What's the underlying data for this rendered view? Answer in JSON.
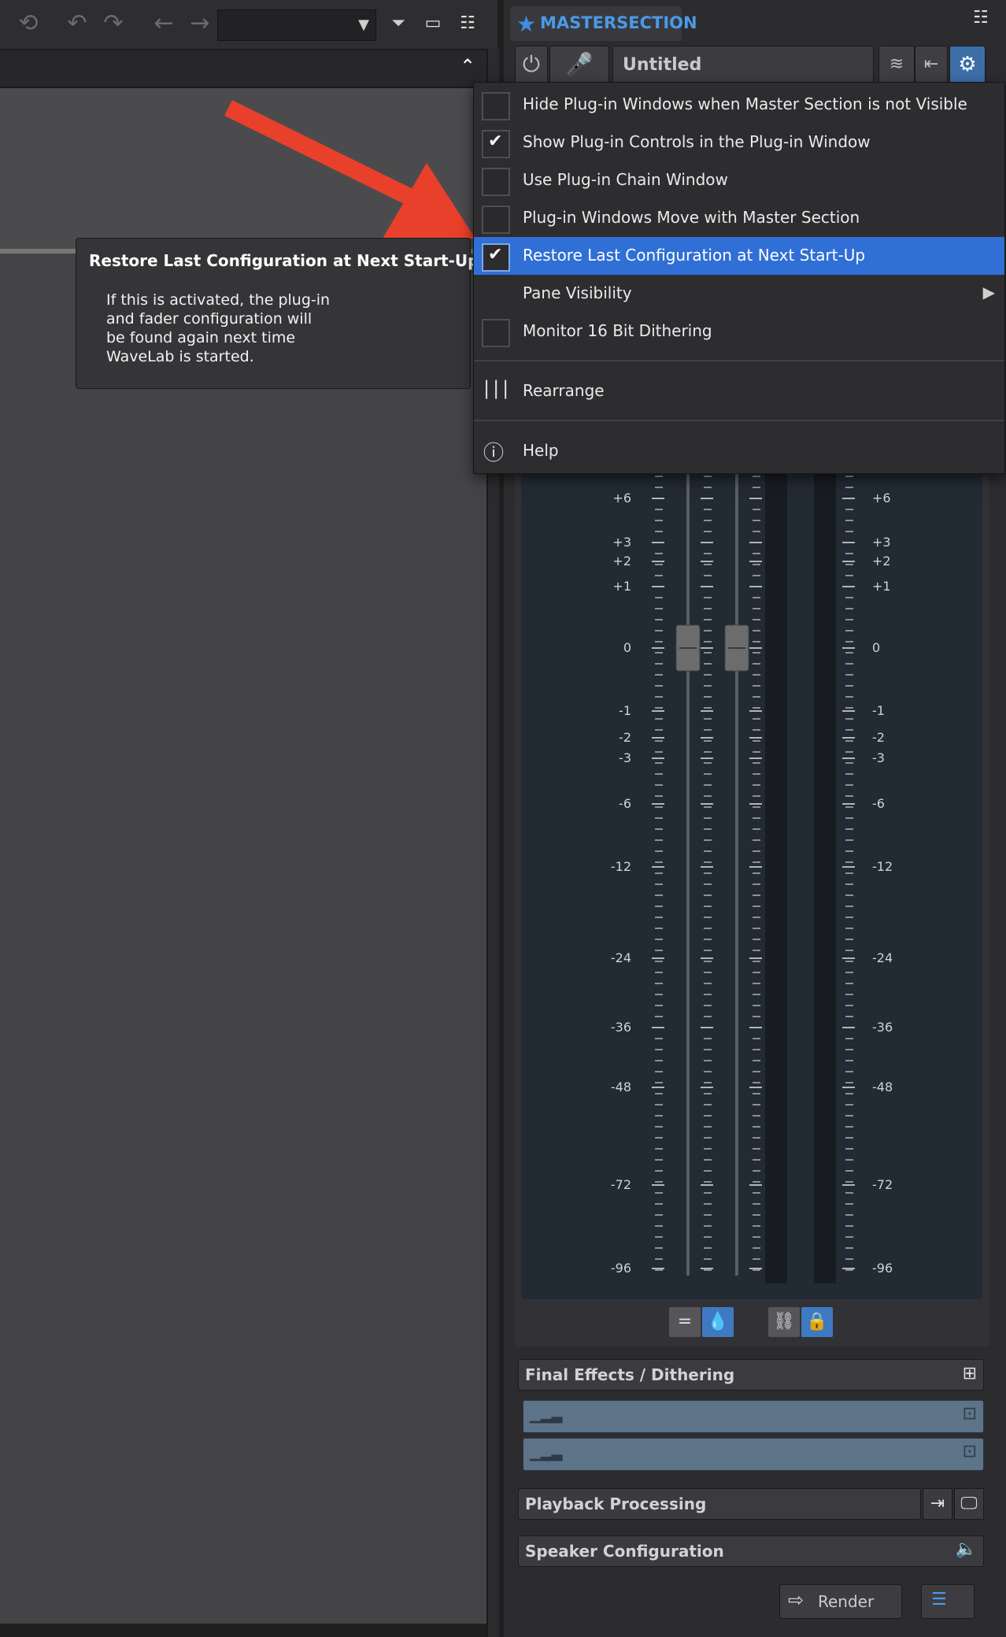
{
  "left_toolbar": {
    "icons": [
      "refresh-icon",
      "undo-icon",
      "redo-icon",
      "arrow-left-icon",
      "arrow-right-icon",
      "collapse-icon",
      "window-icon",
      "layout-icon"
    ]
  },
  "master_section": {
    "tab_title": "MASTERSECTION",
    "preset_name": "Untitled"
  },
  "menu": {
    "items": [
      {
        "label": "Hide Plug-in Windows when Master Section is not Visible",
        "checked": false
      },
      {
        "label": "Show Plug-in Controls in the Plug-in Window",
        "checked": true
      },
      {
        "label": "Use Plug-in Chain Window",
        "checked": false
      },
      {
        "label": "Plug-in Windows Move with Master Section",
        "checked": false
      },
      {
        "label": "Restore Last Configuration at Next Start-Up",
        "checked": true,
        "highlighted": true
      },
      {
        "label": "Pane Visibility",
        "submenu": true
      },
      {
        "label": "Monitor 16 Bit Dithering",
        "checked": false
      }
    ],
    "rearrange": "Rearrange",
    "help": "Help"
  },
  "tooltip": {
    "title": "Restore Last Configuration at Next Start-Up",
    "body": "If this is activated, the plug-in and fader configuration will be found again next time WaveLab is started."
  },
  "meter_scale": [
    "+6",
    "+3",
    "+2",
    "+1",
    "0",
    "-1",
    "-2",
    "-3",
    "-6",
    "-12",
    "-24",
    "-36",
    "-48",
    "-72",
    "-96"
  ],
  "sections": {
    "final_effects": "Final Effects / Dithering",
    "playback_processing": "Playback Processing",
    "speaker_configuration": "Speaker Configuration",
    "render": "Render"
  },
  "colors": {
    "accent": "#2f6fd6",
    "tab_title": "#4a9ae8",
    "arrow": "#e8402a"
  }
}
